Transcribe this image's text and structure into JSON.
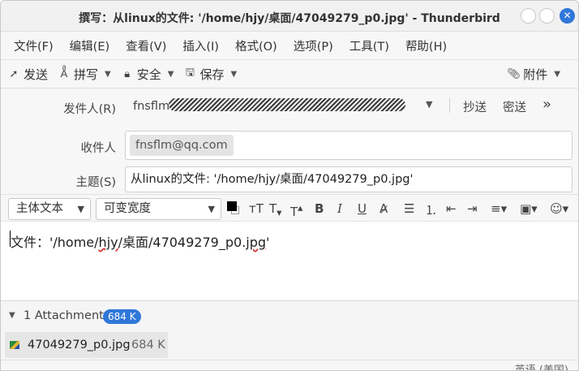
{
  "window": {
    "title": "撰写：从linux的文件: '/home/hjy/桌面/47049279_p0.jpg' - Thunderbird"
  },
  "menu": [
    "文件(F)",
    "编辑(E)",
    "查看(V)",
    "插入(I)",
    "格式(O)",
    "选项(P)",
    "工具(T)",
    "帮助(H)"
  ],
  "toolbar": {
    "send": "发送",
    "spell": "拼写",
    "security": "安全",
    "save": "保存",
    "attach": "附件"
  },
  "header": {
    "from_label": "发件人(R)",
    "from_value": "fnsflm",
    "cc": "抄送",
    "bcc": "密送",
    "to_label": "收件人",
    "to_recipient": "fnsflm@qq.com",
    "subject_label": "主题(S)",
    "subject_value": "从linux的文件: '/home/hjy/桌面/47049279_p0.jpg'"
  },
  "format": {
    "paragraph": "主体文本",
    "font": "可变宽度"
  },
  "body": {
    "prefix": "文件：'/home/",
    "user": "hjy",
    "middle": "/桌面/47049279_p0.",
    "ext": "jpg",
    "suffix": "'"
  },
  "attachments": {
    "summary": "1 Attachment",
    "total_size": "684 K",
    "items": [
      {
        "name": "47049279_p0.jpg",
        "size": "684 K"
      }
    ]
  },
  "status": {
    "language": "英语 (美国)"
  }
}
